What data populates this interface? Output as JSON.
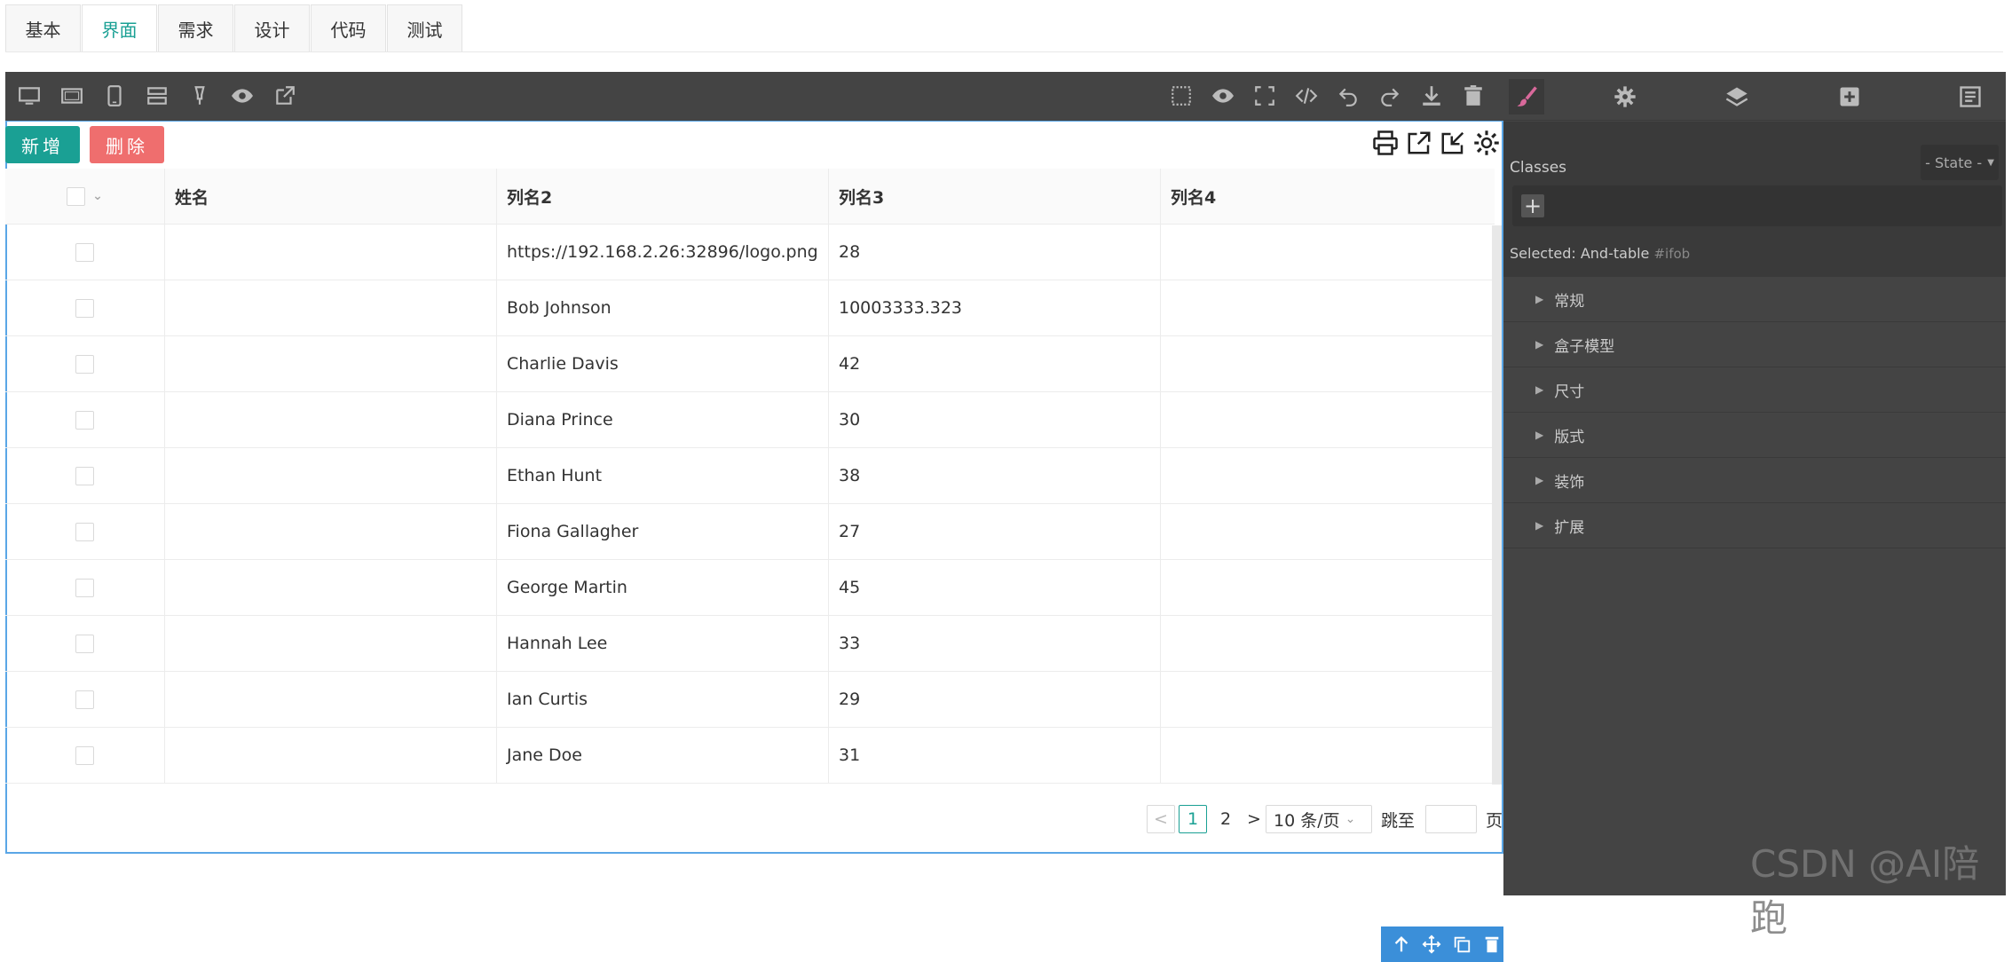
{
  "tabs": [
    {
      "label": "基本"
    },
    {
      "label": "界面"
    },
    {
      "label": "需求"
    },
    {
      "label": "设计"
    },
    {
      "label": "代码"
    },
    {
      "label": "测试"
    }
  ],
  "active_tab": 1,
  "canvas": {
    "add_button": "新增",
    "delete_button": "删除",
    "table": {
      "columns": [
        "姓名",
        "列名2",
        "列名3",
        "列名4"
      ],
      "rows": [
        {
          "c1": "",
          "c2": "https://192.168.2.26:32896/logo.png",
          "c3": "28",
          "c4": ""
        },
        {
          "c1": "",
          "c2": "Bob Johnson",
          "c3": "10003333.323",
          "c4": ""
        },
        {
          "c1": "",
          "c2": "Charlie Davis",
          "c3": "42",
          "c4": ""
        },
        {
          "c1": "",
          "c2": "Diana Prince",
          "c3": "30",
          "c4": ""
        },
        {
          "c1": "",
          "c2": "Ethan Hunt",
          "c3": "38",
          "c4": ""
        },
        {
          "c1": "",
          "c2": "Fiona Gallagher",
          "c3": "27",
          "c4": ""
        },
        {
          "c1": "",
          "c2": "George Martin",
          "c3": "45",
          "c4": ""
        },
        {
          "c1": "",
          "c2": "Hannah Lee",
          "c3": "33",
          "c4": ""
        },
        {
          "c1": "",
          "c2": "Ian Curtis",
          "c3": "29",
          "c4": ""
        },
        {
          "c1": "",
          "c2": "Jane Doe",
          "c3": "31",
          "c4": ""
        }
      ]
    },
    "pager": {
      "prev": "<",
      "page1": "1",
      "page2": "2",
      "next": ">",
      "page_size": "10 条/页",
      "jump_label": "跳至",
      "jump_value": "",
      "page_suffix": "页"
    }
  },
  "panel": {
    "classes_label": "Classes",
    "state_label": "- State -",
    "add_class": "+",
    "selected_label": "Selected:",
    "selected_name": "And-table",
    "selected_id": "#ifob",
    "sectors": [
      "常规",
      "盒子模型",
      "尺寸",
      "版式",
      "装饰",
      "扩展"
    ]
  },
  "watermark": "CSDN @AI陪跑",
  "colors": {
    "accent": "#1aa094",
    "danger": "#ef6e6e",
    "select": "#3b8fd9",
    "pink": "#d9699b"
  }
}
